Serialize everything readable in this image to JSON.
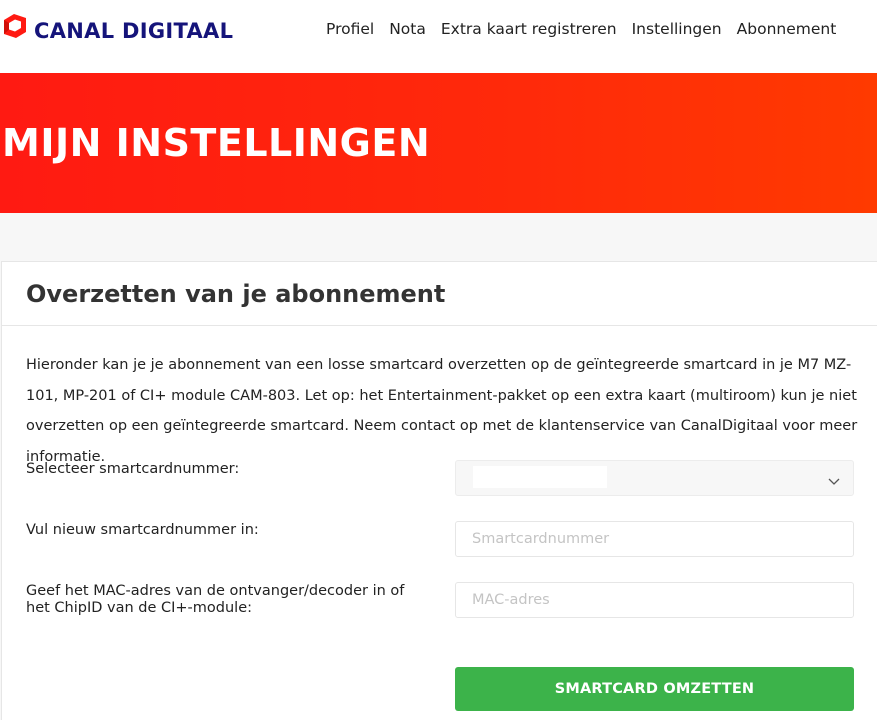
{
  "brand": {
    "name": "CANAL DIGITAAL",
    "logo_icon": "canal-digitaal-logo-icon",
    "colors": {
      "brand_blue": "#15147a",
      "brand_red": "#ff1a12",
      "accent_green": "#3cb34a"
    }
  },
  "nav": {
    "items": [
      {
        "label": "Profiel"
      },
      {
        "label": "Nota"
      },
      {
        "label": "Extra kaart registreren"
      },
      {
        "label": "Instellingen"
      },
      {
        "label": "Abonnement"
      }
    ]
  },
  "hero": {
    "title": "MIJN INSTELLINGEN"
  },
  "card": {
    "title": "Overzetten van je abonnement",
    "intro": "Hieronder kan je je abonnement van een losse smartcard overzetten op de geïntegreerde smartcard in je M7 MZ-101, MP-201 of CI+ module CAM-803. Let op: het Entertainment-pakket op een extra kaart (multiroom) kun je niet overzetten op een geïntegreerde smartcard. Neem contact op met de klantenservice van CanalDigitaal voor meer informatie.",
    "form": {
      "select_label": "Selecteer smartcardnummer:",
      "select_value": "",
      "new_card_label": "Vul nieuw smartcardnummer in:",
      "new_card_placeholder": "Smartcardnummer",
      "mac_label": "Geef het MAC-adres van de ontvanger/decoder in of het ChipID van de CI+-module:",
      "mac_placeholder": "MAC-adres",
      "submit_label": "SMARTCARD OMZETTEN"
    }
  }
}
